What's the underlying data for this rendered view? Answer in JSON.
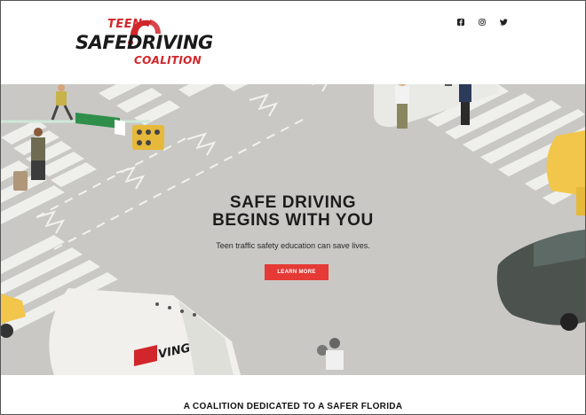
{
  "logo": {
    "teen": "TEEN",
    "safe": "SAFE",
    "driving": "DRIVING",
    "coalition": "COALITION"
  },
  "social": [
    {
      "icon": "facebook-icon"
    },
    {
      "icon": "instagram-icon"
    },
    {
      "icon": "twitter-icon"
    }
  ],
  "hero": {
    "title_line1": "SAFE DRIVING",
    "title_line2": "BEGINS WITH YOU",
    "subtitle": "Teen traffic safety education can save lives.",
    "cta_label": "LEARN MORE",
    "truck_text": "VING"
  },
  "section": {
    "title": "A COALITION DEDICATED TO A SAFER FLORIDA"
  },
  "colors": {
    "accent": "#e53a35",
    "brand_red": "#d1262b",
    "road": "#c9c8c4"
  }
}
